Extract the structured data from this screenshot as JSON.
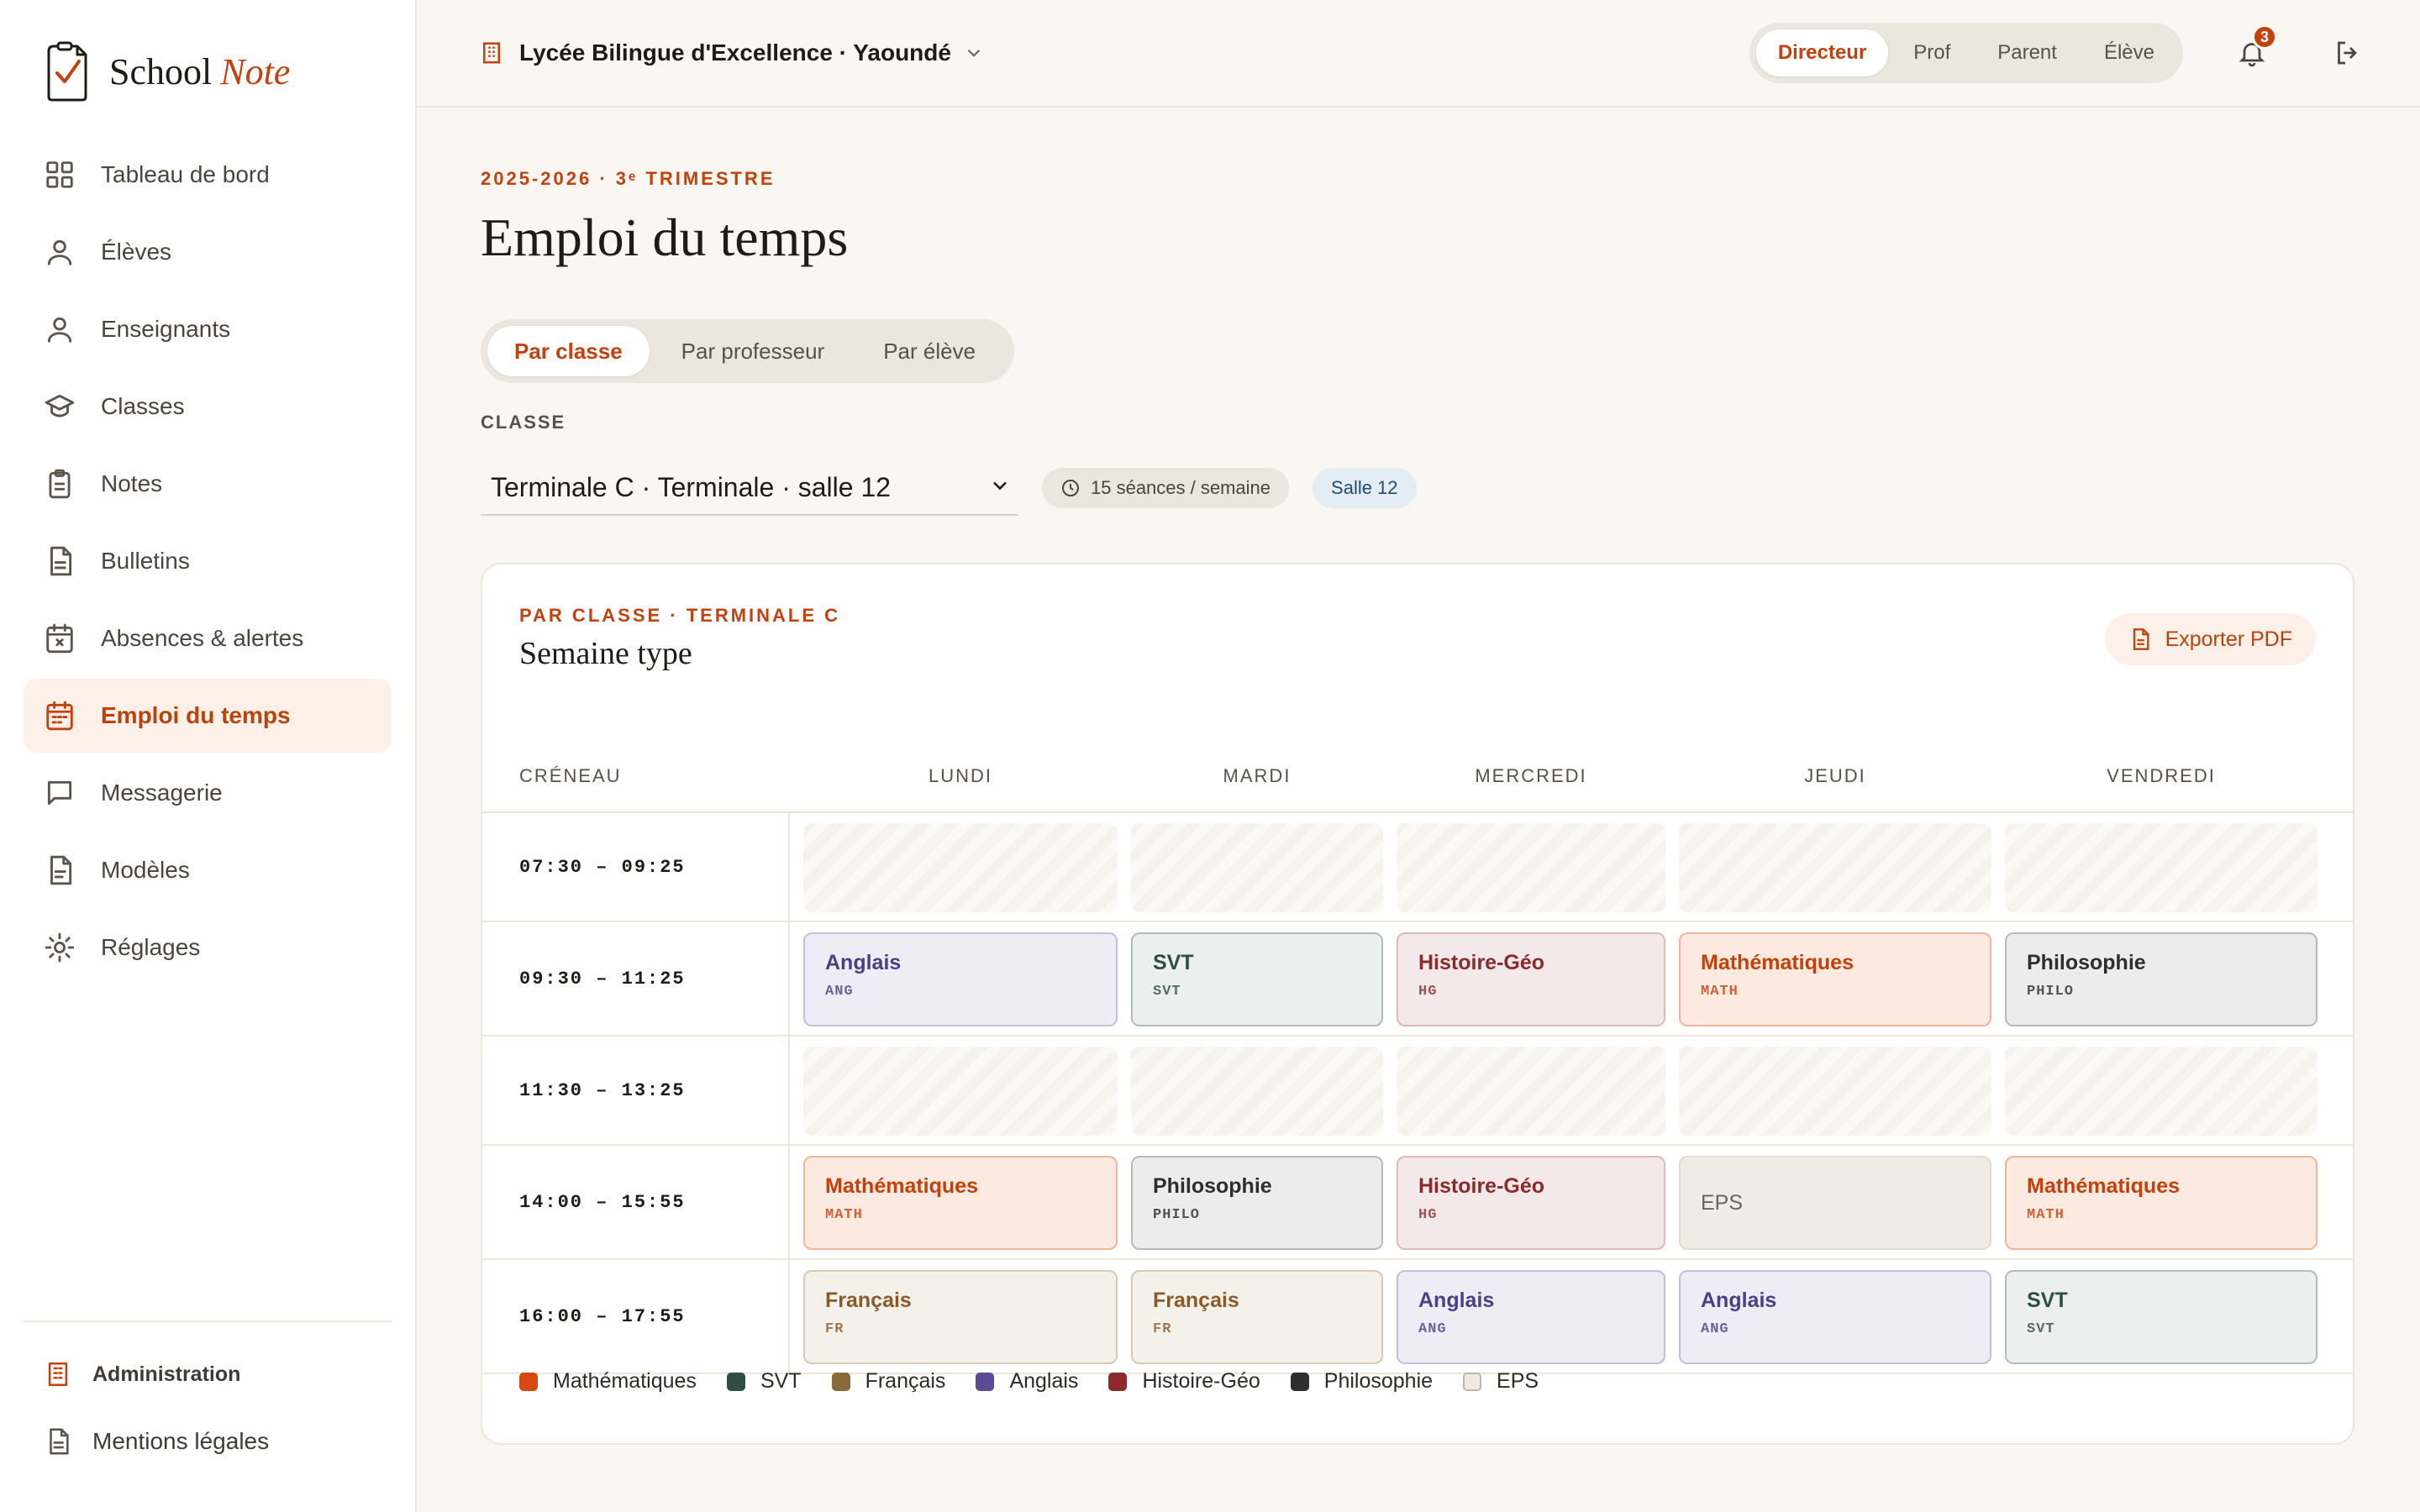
{
  "brand": {
    "name": "School",
    "accent": "Note"
  },
  "sidebar": {
    "items": [
      {
        "label": "Tableau de bord",
        "icon": "dashboard-icon"
      },
      {
        "label": "Élèves",
        "icon": "user-icon"
      },
      {
        "label": "Enseignants",
        "icon": "teacher-icon"
      },
      {
        "label": "Classes",
        "icon": "graduation-cap-icon"
      },
      {
        "label": "Notes",
        "icon": "clipboard-icon"
      },
      {
        "label": "Bulletins",
        "icon": "document-icon"
      },
      {
        "label": "Absences & alertes",
        "icon": "calendar-x-icon"
      },
      {
        "label": "Emploi du temps",
        "icon": "calendar-icon",
        "active": true
      },
      {
        "label": "Messagerie",
        "icon": "chat-icon"
      },
      {
        "label": "Modèles",
        "icon": "template-icon"
      },
      {
        "label": "Réglages",
        "icon": "settings-icon"
      }
    ],
    "footer": {
      "admin": "Administration",
      "legal": "Mentions légales"
    }
  },
  "topbar": {
    "school": "Lycée Bilingue d'Excellence · Yaoundé",
    "roles": [
      "Directeur",
      "Prof",
      "Parent",
      "Élève"
    ],
    "active_role": "Directeur",
    "notifications": "3"
  },
  "page": {
    "eyebrow": "2025-2026 · 3ᵉ TRIMESTRE",
    "title": "Emploi du temps",
    "tabs": [
      "Par classe",
      "Par professeur",
      "Par élève"
    ],
    "active_tab": "Par classe",
    "class_label": "CLASSE",
    "class_value": "Terminale C · Terminale · salle 12",
    "sessions_chip": "15 séances / semaine",
    "room_chip": "Salle 12"
  },
  "timetable": {
    "eyebrow": "PAR CLASSE · TERMINALE C",
    "title": "Semaine type",
    "export_label": "Exporter PDF",
    "slot_header": "CRÉNEAU",
    "days": [
      "LUNDI",
      "MARDI",
      "MERCREDI",
      "JEUDI",
      "VENDREDI"
    ],
    "rows": [
      {
        "slot": "07:30 – 09:25",
        "cells": [
          null,
          null,
          null,
          null,
          null
        ]
      },
      {
        "slot": "09:30 – 11:25",
        "cells": [
          {
            "subject": "Anglais",
            "code": "ANG",
            "kind": "ang"
          },
          {
            "subject": "SVT",
            "code": "SVT",
            "kind": "svt"
          },
          {
            "subject": "Histoire-Géo",
            "code": "HG",
            "kind": "hg"
          },
          {
            "subject": "Mathématiques",
            "code": "MATH",
            "kind": "math"
          },
          {
            "subject": "Philosophie",
            "code": "PHILO",
            "kind": "philo"
          }
        ]
      },
      {
        "slot": "11:30 – 13:25",
        "cells": [
          null,
          null,
          null,
          null,
          null
        ]
      },
      {
        "slot": "14:00 – 15:55",
        "cells": [
          {
            "subject": "Mathématiques",
            "code": "MATH",
            "kind": "math"
          },
          {
            "subject": "Philosophie",
            "code": "PHILO",
            "kind": "philo"
          },
          {
            "subject": "Histoire-Géo",
            "code": "HG",
            "kind": "hg"
          },
          {
            "subject": "EPS",
            "code": "",
            "kind": "eps"
          },
          {
            "subject": "Mathématiques",
            "code": "MATH",
            "kind": "math"
          }
        ]
      },
      {
        "slot": "16:00 – 17:55",
        "cells": [
          {
            "subject": "Français",
            "code": "FR",
            "kind": "fr"
          },
          {
            "subject": "Français",
            "code": "FR",
            "kind": "fr"
          },
          {
            "subject": "Anglais",
            "code": "ANG",
            "kind": "ang"
          },
          {
            "subject": "Anglais",
            "code": "ANG",
            "kind": "ang"
          },
          {
            "subject": "SVT",
            "code": "SVT",
            "kind": "svt"
          }
        ]
      }
    ],
    "legend": [
      {
        "label": "Mathématiques",
        "kind": "math"
      },
      {
        "label": "SVT",
        "kind": "svt"
      },
      {
        "label": "Français",
        "kind": "fr"
      },
      {
        "label": "Anglais",
        "kind": "ang"
      },
      {
        "label": "Histoire-Géo",
        "kind": "hg"
      },
      {
        "label": "Philosophie",
        "kind": "philo"
      },
      {
        "label": "EPS",
        "kind": "eps"
      }
    ]
  },
  "subject_colors": {
    "math": {
      "swatch": "#d9480f",
      "bg": "#fce9e0",
      "border": "#f0b59b",
      "text": "#c2410c"
    },
    "svt": {
      "swatch": "#2f4f43",
      "bg": "#ecefed",
      "border": "#b3bdb8",
      "text": "#2f4f43"
    },
    "fr": {
      "swatch": "#8a6a3a",
      "bg": "#f4f0ea",
      "border": "#d6c9b6",
      "text": "#8a5a2a"
    },
    "ang": {
      "swatch": "#5b4b96",
      "bg": "#eeedf5",
      "border": "#c3bedc",
      "text": "#4b3f86"
    },
    "hg": {
      "swatch": "#8a2a2a",
      "bg": "#f4e9ea",
      "border": "#ddb9bc",
      "text": "#8a2a2a"
    },
    "philo": {
      "swatch": "#2e2e2e",
      "bg": "#ececec",
      "border": "#b9b9b9",
      "text": "#2e2e2e"
    },
    "eps": {
      "swatch": "#efe9e0",
      "bg": "#efebe5",
      "border": "#e2dbd0",
      "text": "#6a645c"
    }
  }
}
